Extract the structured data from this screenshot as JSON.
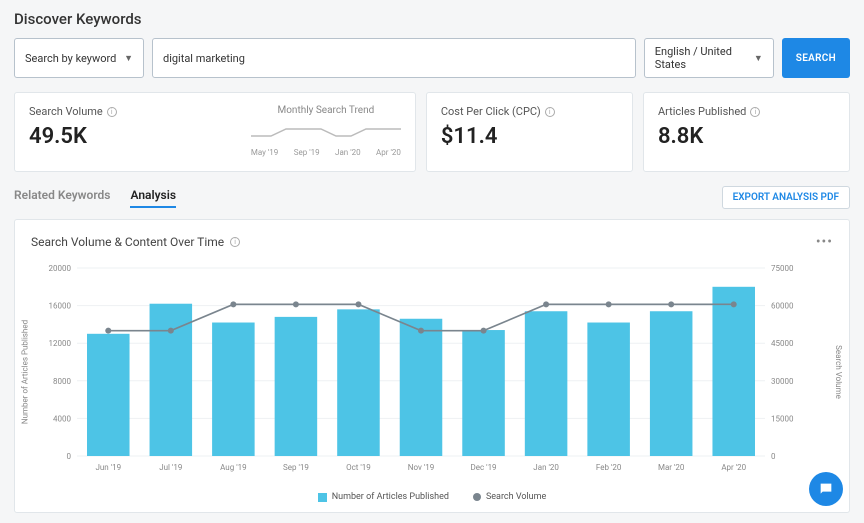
{
  "page_title": "Discover Keywords",
  "search": {
    "mode_label": "Search by keyword",
    "keyword_value": "digital marketing",
    "lang_label": "English / United States",
    "button": "SEARCH"
  },
  "metrics": {
    "search_volume": {
      "label": "Search Volume",
      "value": "49.5K"
    },
    "trend": {
      "label": "Monthly Search Trend",
      "ticks": [
        "May '19",
        "Sep '19",
        "Jan '20",
        "Apr '20"
      ]
    },
    "cpc": {
      "label": "Cost Per Click (CPC)",
      "value": "$11.4"
    },
    "articles": {
      "label": "Articles Published",
      "value": "8.8K"
    }
  },
  "tabs": {
    "related": "Related Keywords",
    "analysis": "Analysis"
  },
  "export_button": "EXPORT ANALYSIS PDF",
  "chart": {
    "title": "Search Volume & Content Over Time",
    "y_left_label": "Number of Articles Published",
    "y_right_label": "Search Volume",
    "legend_bars": "Number of Articles Published",
    "legend_line": "Search Volume"
  },
  "chart_data": {
    "type": "bar",
    "categories": [
      "Jun '19",
      "Jul '19",
      "Aug '19",
      "Sep '19",
      "Oct '19",
      "Nov '19",
      "Dec '19",
      "Jan '20",
      "Feb '20",
      "Mar '20",
      "Apr '20"
    ],
    "series": [
      {
        "name": "Number of Articles Published",
        "type": "bar",
        "axis": "left",
        "values": [
          13000,
          16200,
          14200,
          14800,
          15600,
          14600,
          13400,
          15400,
          14200,
          15400,
          18000
        ]
      },
      {
        "name": "Search Volume",
        "type": "line",
        "axis": "right",
        "values": [
          50000,
          50000,
          60500,
          60500,
          60500,
          50000,
          50000,
          60500,
          60500,
          60500,
          60500
        ]
      }
    ],
    "y_left": {
      "min": 0,
      "max": 20000,
      "step": 4000,
      "label": "Number of Articles Published"
    },
    "y_right": {
      "min": 0,
      "max": 75000,
      "step": 15000,
      "label": "Search Volume"
    }
  }
}
